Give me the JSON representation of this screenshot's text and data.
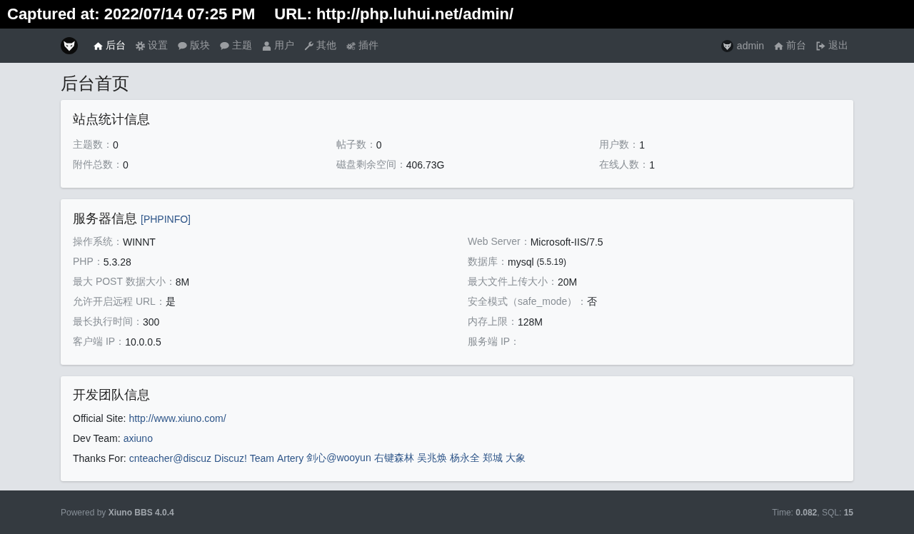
{
  "capture_banner": {
    "captured_at": "Captured at: 2022/07/14 07:25 PM",
    "url": "URL: http://php.luhui.net/admin/"
  },
  "navbar": {
    "items": [
      {
        "label": "后台",
        "selected": true
      },
      {
        "label": "设置",
        "selected": false
      },
      {
        "label": "版块",
        "selected": false
      },
      {
        "label": "主题",
        "selected": false
      },
      {
        "label": "用户",
        "selected": false
      },
      {
        "label": "其他",
        "selected": false
      },
      {
        "label": "插件",
        "selected": false
      }
    ],
    "user": {
      "name": "admin"
    },
    "right_links": [
      {
        "label": "前台"
      },
      {
        "label": "退出"
      }
    ]
  },
  "page_title": "后台首页",
  "stats_card": {
    "title": "站点统计信息",
    "items": [
      {
        "label": "主题数：",
        "value": "0"
      },
      {
        "label": "帖子数：",
        "value": "0"
      },
      {
        "label": "用户数：",
        "value": "1"
      },
      {
        "label": "附件总数：",
        "value": "0"
      },
      {
        "label": "磁盘剩余空间：",
        "value": "406.73G"
      },
      {
        "label": "在线人数：",
        "value": "1"
      }
    ]
  },
  "server_card": {
    "title": "服务器信息",
    "link": "[PHPINFO]",
    "items": [
      {
        "label": "操作系统：",
        "value": "WINNT"
      },
      {
        "label": "Web Server：",
        "value": "Microsoft-IIS/7.5"
      },
      {
        "label": "PHP：",
        "value": "5.3.28"
      },
      {
        "label": "数据库：",
        "value": "mysql",
        "note": "(5.5.19)"
      },
      {
        "label": "最大 POST 数据大小：",
        "value": "8M"
      },
      {
        "label": "最大文件上传大小：",
        "value": "20M"
      },
      {
        "label": "允许开启远程 URL：",
        "value": "是"
      },
      {
        "label": "安全模式（safe_mode）：",
        "value": "否"
      },
      {
        "label": "最长执行时间：",
        "value": "300"
      },
      {
        "label": "内存上限：",
        "value": "128M"
      },
      {
        "label": "客户端 IP：",
        "value": "10.0.0.5"
      },
      {
        "label": "服务端 IP："
      }
    ]
  },
  "team_card": {
    "title": "开发团队信息",
    "lines": [
      {
        "label": "Official Site:",
        "links": [
          "http://www.xiuno.com/"
        ]
      },
      {
        "label": "Dev Team:",
        "links": [
          "axiuno"
        ]
      },
      {
        "label": "Thanks For:",
        "links": [
          "cnteacher@discuz",
          "Discuz! Team",
          "Artery",
          "剑心@wooyun",
          "右键森林",
          "吴兆焕",
          "杨永全",
          "郑城",
          "大象"
        ]
      }
    ]
  },
  "footer": {
    "powered_by": "Powered by **Xiuno BBS 4.0.4**",
    "stats": "Time: **0.082**, SQL: **15**"
  }
}
